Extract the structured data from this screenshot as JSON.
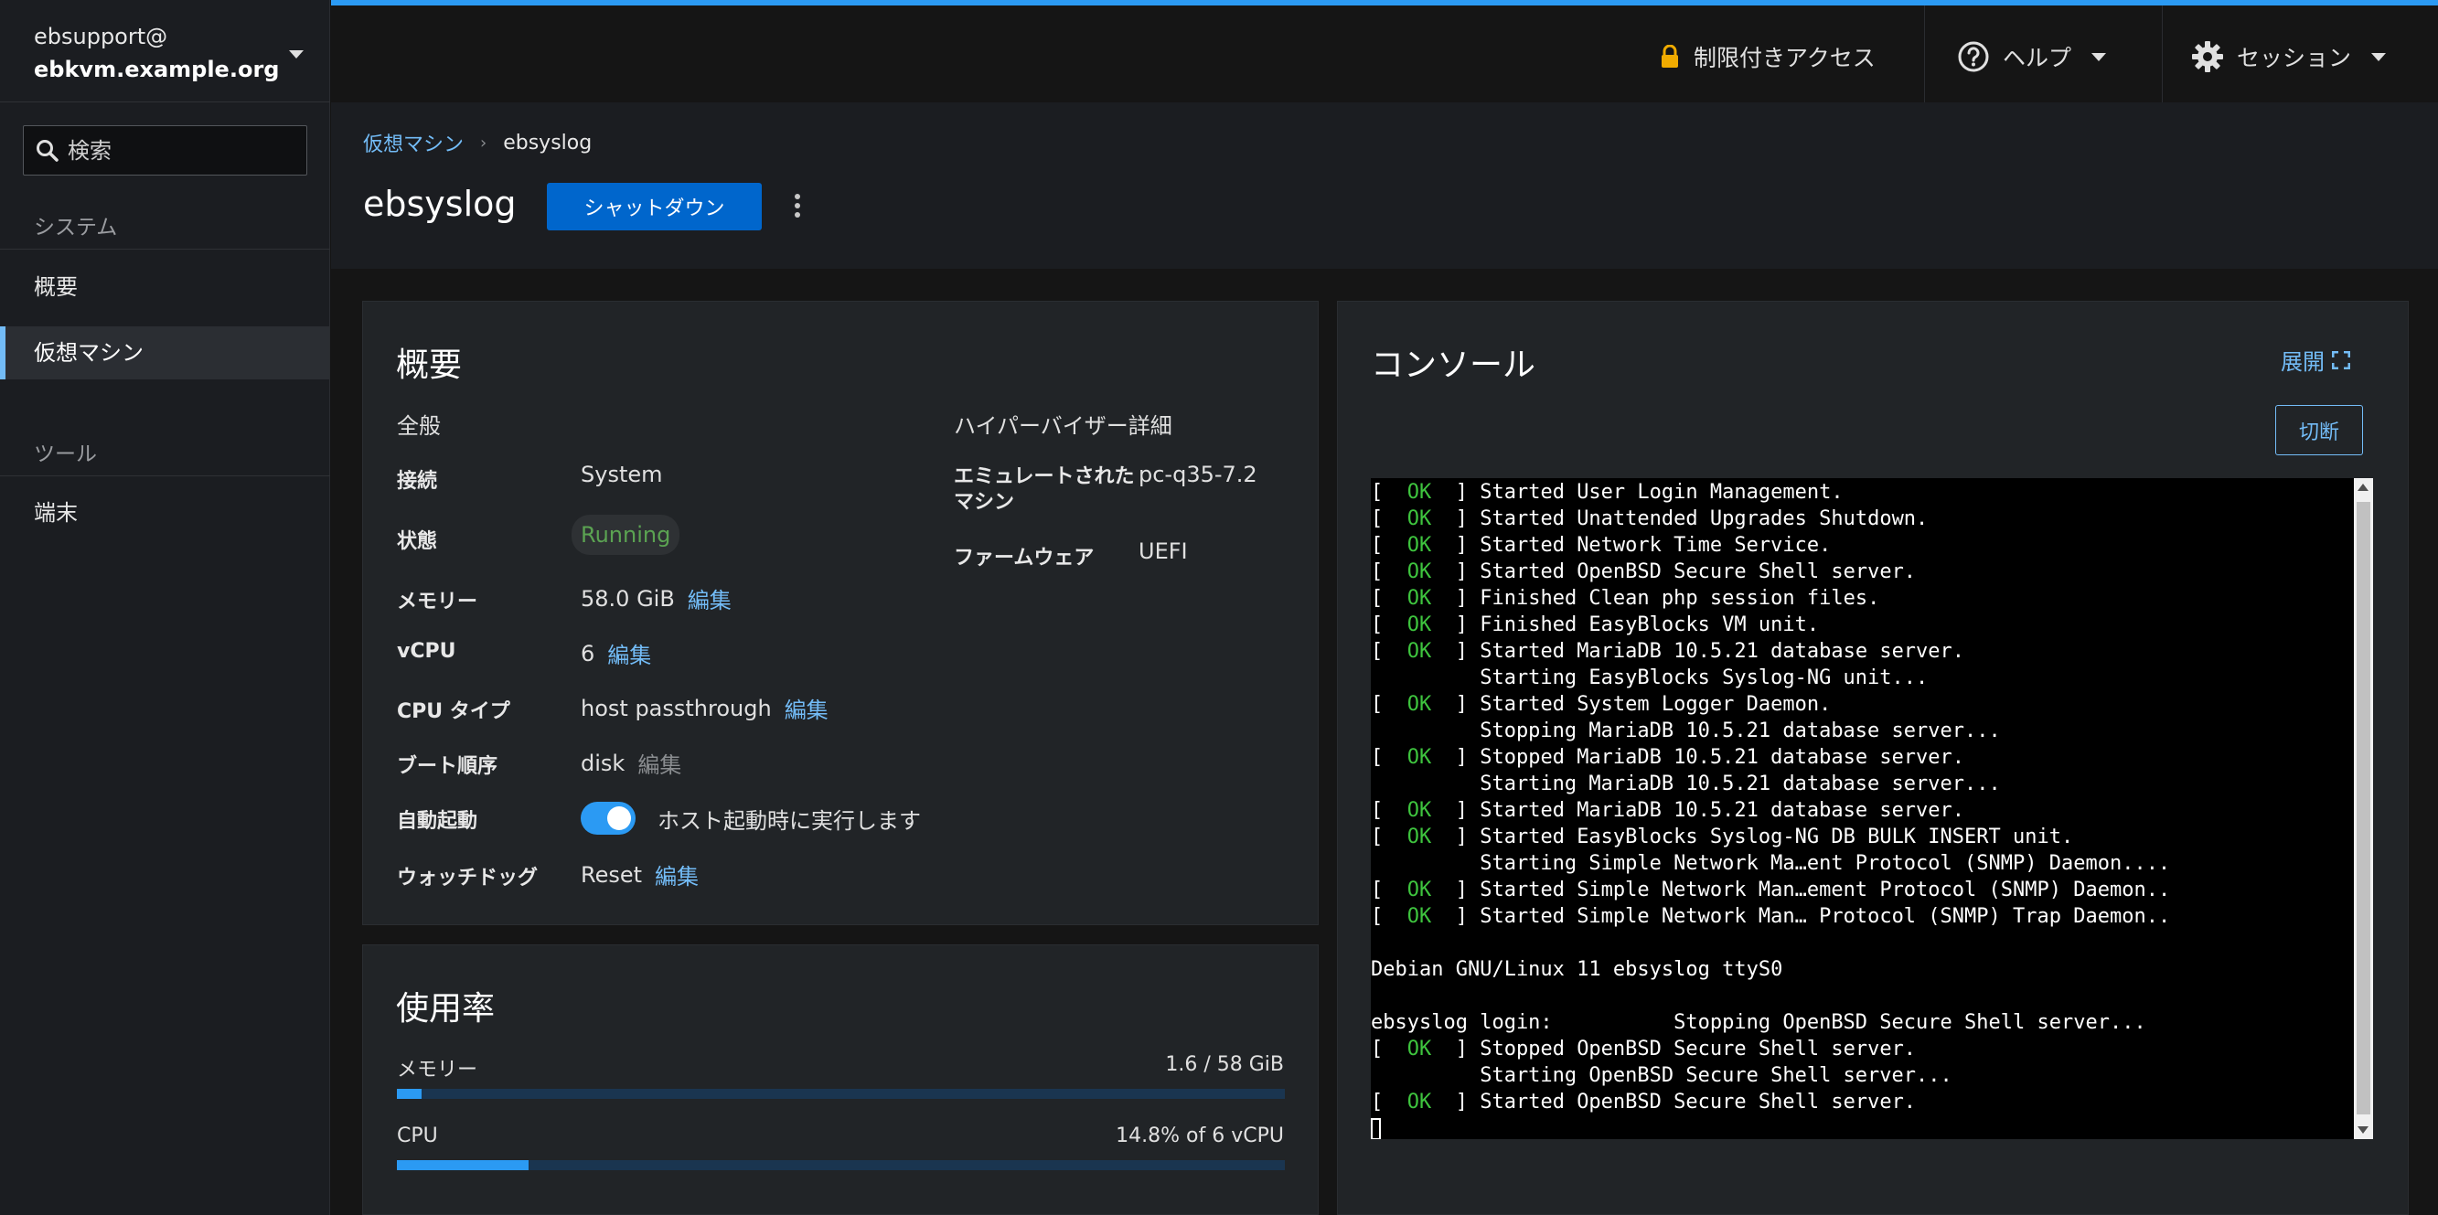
{
  "host": {
    "user": "ebsupport@",
    "name": "ebkvm.example.org"
  },
  "search": {
    "placeholder": "検索"
  },
  "nav": {
    "system_section": "システム",
    "tools_section": "ツール",
    "items": [
      {
        "label": "概要"
      },
      {
        "label": "仮想マシン"
      },
      {
        "label": "端末"
      }
    ]
  },
  "masthead": {
    "restricted": "制限付きアクセス",
    "help": "ヘルプ",
    "session": "セッション"
  },
  "breadcrumb": {
    "parent": "仮想マシン",
    "current": "ebsyslog"
  },
  "page": {
    "title": "ebsyslog",
    "shutdown": "シャットダウン"
  },
  "overview": {
    "title": "概要",
    "general": "全般",
    "hypervisor": "ハイパーバイザー詳細",
    "edit": "編集",
    "fields": {
      "connection": {
        "label": "接続",
        "value": "System"
      },
      "state": {
        "label": "状態",
        "value": "Running"
      },
      "memory": {
        "label": "メモリー",
        "value": "58.0 GiB"
      },
      "vcpu": {
        "label": "vCPU",
        "value": "6"
      },
      "cpu_type": {
        "label": "CPU タイプ",
        "value": "host passthrough"
      },
      "boot_order": {
        "label": "ブート順序",
        "value": "disk"
      },
      "autostart": {
        "label": "自動起動",
        "value": "ホスト起動時に実行します",
        "enabled": true
      },
      "watchdog": {
        "label": "ウォッチドッグ",
        "value": "Reset"
      },
      "emulated_machine": {
        "label_line1": "エミュレートされた",
        "label_line2": "マシン",
        "value": "pc-q35-7.2"
      },
      "firmware": {
        "label": "ファームウェア",
        "value": "UEFI"
      }
    }
  },
  "usage": {
    "title": "使用率",
    "memory": {
      "label": "メモリー",
      "value": "1.6 / 58 GiB",
      "fraction": 0.0276
    },
    "cpu": {
      "label": "CPU",
      "value": "14.8% of 6 vCPU",
      "fraction": 0.148
    }
  },
  "console": {
    "title": "コンソール",
    "expand": "展開",
    "disconnect": "切断",
    "lines": [
      {
        "ok": true,
        "text": "Started User Login Management."
      },
      {
        "ok": true,
        "text": "Started Unattended Upgrades Shutdown."
      },
      {
        "ok": true,
        "text": "Started Network Time Service."
      },
      {
        "ok": true,
        "text": "Started OpenBSD Secure Shell server."
      },
      {
        "ok": true,
        "text": "Finished Clean php session files."
      },
      {
        "ok": true,
        "text": "Finished EasyBlocks VM unit."
      },
      {
        "ok": true,
        "text": "Started MariaDB 10.5.21 database server."
      },
      {
        "ok": false,
        "text": "         Starting EasyBlocks Syslog-NG unit..."
      },
      {
        "ok": true,
        "text": "Started System Logger Daemon."
      },
      {
        "ok": false,
        "text": "         Stopping MariaDB 10.5.21 database server..."
      },
      {
        "ok": true,
        "text": "Stopped MariaDB 10.5.21 database server."
      },
      {
        "ok": false,
        "text": "         Starting MariaDB 10.5.21 database server..."
      },
      {
        "ok": true,
        "text": "Started MariaDB 10.5.21 database server."
      },
      {
        "ok": true,
        "text": "Started EasyBlocks Syslog-NG DB BULK INSERT unit."
      },
      {
        "ok": false,
        "text": "         Starting Simple Network Ma…ent Protocol (SNMP) Daemon...."
      },
      {
        "ok": true,
        "text": "Started Simple Network Man…ement Protocol (SNMP) Daemon.."
      },
      {
        "ok": true,
        "text": "Started Simple Network Man… Protocol (SNMP) Trap Daemon.."
      },
      {
        "ok": false,
        "text": ""
      },
      {
        "ok": false,
        "text": "Debian GNU/Linux 11 ebsyslog ttyS0"
      },
      {
        "ok": false,
        "text": ""
      },
      {
        "ok": false,
        "text": "ebsyslog login:          Stopping OpenBSD Secure Shell server..."
      },
      {
        "ok": true,
        "text": "Stopped OpenBSD Secure Shell server."
      },
      {
        "ok": false,
        "text": "         Starting OpenBSD Secure Shell server..."
      },
      {
        "ok": true,
        "text": "Started OpenBSD Secure Shell server."
      }
    ],
    "ok_text": "OK"
  },
  "colors": {
    "accent": "#2b9af3",
    "link": "#73bcf7",
    "primary_button": "#0066cc",
    "running": "#5ba352",
    "terminal_ok": "#3ec43e"
  },
  "icons": {
    "lock": "lock-icon",
    "help": "help-circle-icon",
    "session": "gear-icon",
    "expand": "expand-icon",
    "search": "search-icon"
  }
}
